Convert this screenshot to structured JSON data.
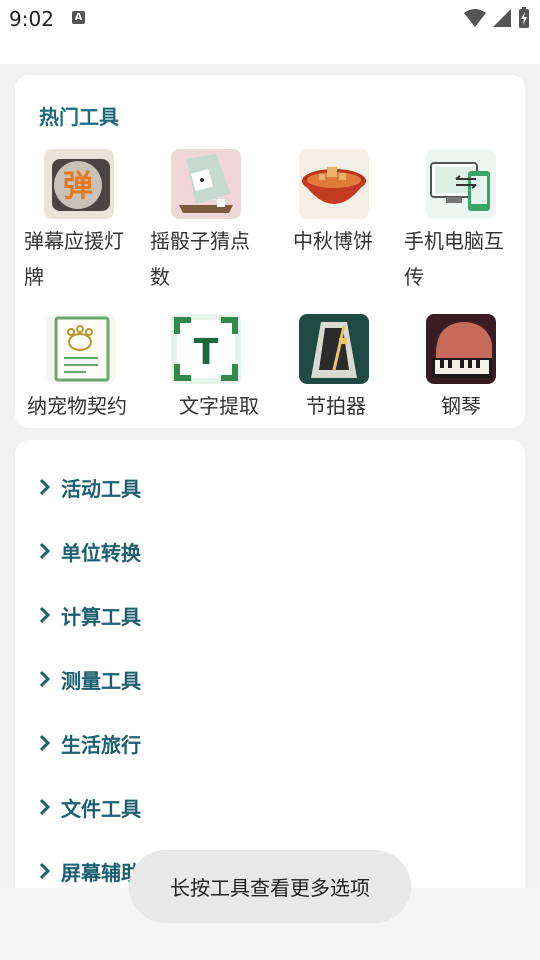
{
  "status": {
    "time": "9:02",
    "badge": "A"
  },
  "hot_tools": {
    "title": "热门工具",
    "items": [
      {
        "line1": "弹幕应援灯",
        "line2": "牌",
        "icon": "danmaku-lightboard-icon",
        "glyph": "弹"
      },
      {
        "line1": "摇骰子猜点",
        "line2": "数",
        "icon": "dice-icon"
      },
      {
        "line1": "中秋博饼",
        "line2": "",
        "icon": "mooncake-bowl-icon"
      },
      {
        "line1": "手机电脑互",
        "line2": "传",
        "icon": "phone-pc-transfer-icon"
      },
      {
        "line1": "纳宠物契约",
        "line2": "",
        "icon": "pet-contract-icon"
      },
      {
        "line1": "文字提取",
        "line2": "",
        "icon": "text-extract-icon",
        "glyph": "T"
      },
      {
        "line1": "节拍器",
        "line2": "",
        "icon": "metronome-icon"
      },
      {
        "line1": "钢琴",
        "line2": "",
        "icon": "piano-icon"
      }
    ]
  },
  "categories": [
    "活动工具",
    "单位转换",
    "计算工具",
    "测量工具",
    "生活旅行",
    "文件工具",
    "屏幕辅助"
  ],
  "toast": "长按工具查看更多选项",
  "colors": {
    "accent": "#1b6a7c",
    "background": "#f1f1f1"
  }
}
